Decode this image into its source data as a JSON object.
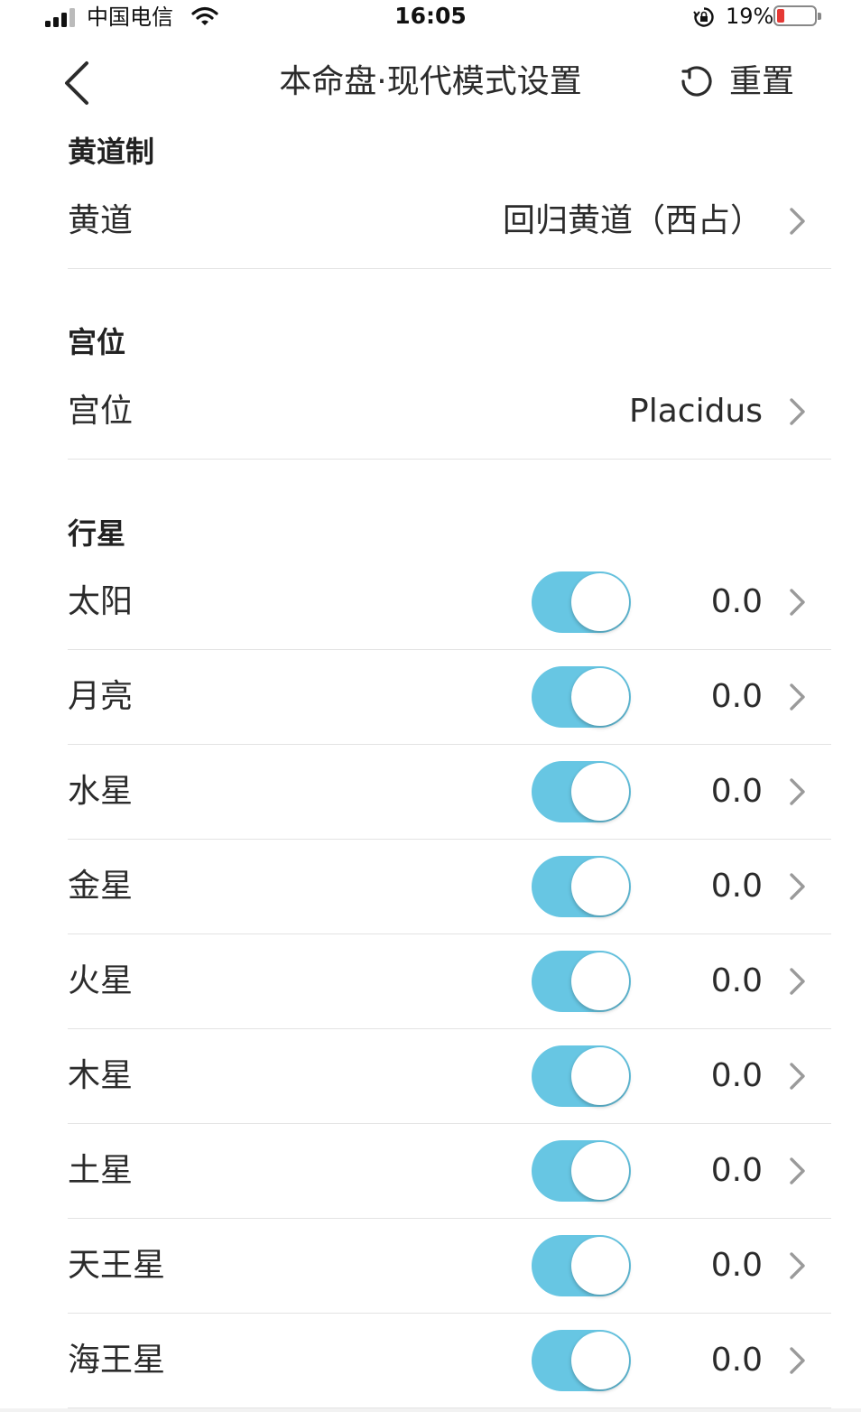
{
  "status_bar": {
    "carrier": "中国电信",
    "time": "16:05",
    "battery_percent": "19%",
    "battery_level": 0.19,
    "battery_color": "#e53935"
  },
  "nav": {
    "title": "本命盘·现代模式设置",
    "back_icon": "chevron-left-icon",
    "reset_icon": "refresh-icon",
    "reset_label": "重置"
  },
  "sections": {
    "ecliptic": {
      "header": "黄道制",
      "row_label": "黄道",
      "row_value": "回归黄道（西占）"
    },
    "house": {
      "header": "宫位",
      "row_label": "宫位",
      "row_value": "Placidus"
    },
    "planets": {
      "header": "行星",
      "toggle_color": "#67c6e3",
      "items": [
        {
          "label": "太阳",
          "enabled": true,
          "value": "0.0"
        },
        {
          "label": "月亮",
          "enabled": true,
          "value": "0.0"
        },
        {
          "label": "水星",
          "enabled": true,
          "value": "0.0"
        },
        {
          "label": "金星",
          "enabled": true,
          "value": "0.0"
        },
        {
          "label": "火星",
          "enabled": true,
          "value": "0.0"
        },
        {
          "label": "木星",
          "enabled": true,
          "value": "0.0"
        },
        {
          "label": "土星",
          "enabled": true,
          "value": "0.0"
        },
        {
          "label": "天王星",
          "enabled": true,
          "value": "0.0"
        },
        {
          "label": "海王星",
          "enabled": true,
          "value": "0.0"
        }
      ]
    }
  }
}
